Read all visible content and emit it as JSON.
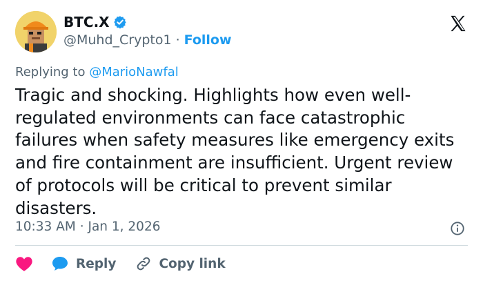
{
  "user": {
    "display_name": "BTC.X",
    "handle": "@Muhd_Crypto1",
    "separator": "·",
    "follow_label": "Follow"
  },
  "reply_context": {
    "prefix": "Replying to ",
    "target": "@MarioNawfal"
  },
  "tweet": {
    "text": "Tragic and shocking. Highlights how even well-regulated environments can face catastrophic failures when safety measures like emergency exits and fire containment are insufficient. Urgent review of protocols will be critical to prevent similar disasters."
  },
  "meta": {
    "time": "10:33 AM",
    "separator": "·",
    "date": "Jan 1, 2026"
  },
  "actions": {
    "reply_label": "Reply",
    "copy_link_label": "Copy link"
  },
  "colors": {
    "accent": "#1d9bf0",
    "like": "#f91880",
    "muted": "#536471",
    "text": "#0f1419"
  },
  "icons": [
    "avatar-icon",
    "verified-badge-icon",
    "x-logo-icon",
    "info-icon",
    "heart-icon",
    "reply-bubble-icon",
    "link-icon"
  ]
}
